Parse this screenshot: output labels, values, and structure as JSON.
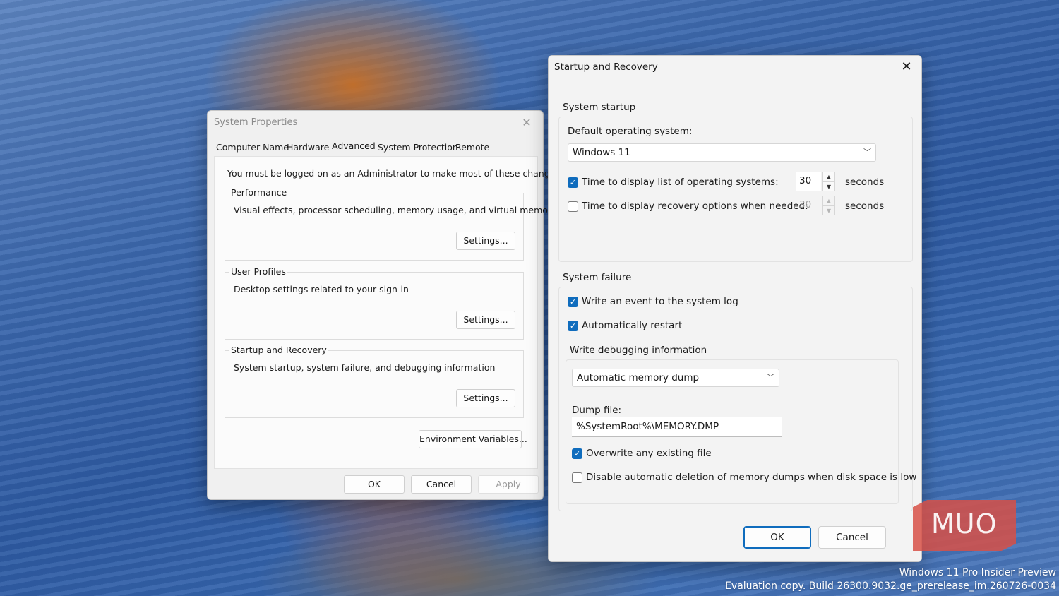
{
  "system_properties": {
    "title": "System Properties",
    "tabs": [
      {
        "label": "Computer Name"
      },
      {
        "label": "Hardware"
      },
      {
        "label": "Advanced"
      },
      {
        "label": "System Protection"
      },
      {
        "label": "Remote"
      }
    ],
    "active_tab": "Advanced",
    "admin_note": "You must be logged on as an Administrator to make most of these changes",
    "performance": {
      "legend": "Performance",
      "description": "Visual effects, processor scheduling, memory usage, and virtual memory",
      "button": "Settings..."
    },
    "user_profiles": {
      "legend": "User Profiles",
      "description": "Desktop settings related to your sign-in",
      "button": "Settings..."
    },
    "startup_recovery": {
      "legend": "Startup and Recovery",
      "description": "System startup, system failure, and debugging information",
      "button": "Settings..."
    },
    "env_button": "Environment Variables...",
    "ok": "OK",
    "cancel": "Cancel",
    "apply": "Apply"
  },
  "startup_recovery_dialog": {
    "title": "Startup and Recovery",
    "system_startup": {
      "title": "System startup",
      "default_os_label": "Default operating system:",
      "default_os_value": "Windows 11",
      "display_list": {
        "label": "Time to display list of operating systems:",
        "checked": true,
        "value": "30",
        "unit": "seconds"
      },
      "display_recovery": {
        "label": "Time to display recovery options when needed:",
        "checked": false,
        "value": "30",
        "unit": "seconds"
      }
    },
    "system_failure": {
      "title": "System failure",
      "write_event": {
        "label": "Write an event to the system log",
        "checked": true
      },
      "auto_restart": {
        "label": "Automatically restart",
        "checked": true
      },
      "debug_title": "Write debugging information",
      "dump_type": "Automatic memory dump",
      "dump_file_label": "Dump file:",
      "dump_file_value": "%SystemRoot%\\MEMORY.DMP",
      "overwrite": {
        "label": "Overwrite any existing file",
        "checked": true
      },
      "disable_auto_delete": {
        "label": "Disable automatic deletion of memory dumps when disk space is low",
        "checked": false
      }
    },
    "ok": "OK",
    "cancel": "Cancel"
  },
  "desktop": {
    "logo_text": "MUO",
    "watermark_line1": "Windows 11 Pro Insider Preview",
    "watermark_line2": "Evaluation copy. Build 26300.9032.ge_prerelease_im.260726-0034"
  },
  "colors": {
    "accent": "#0f6cbd",
    "window_bg": "#f0f0f0"
  },
  "icons": {
    "close": "close-icon",
    "chevron": "chevron-down-icon",
    "check": "checkmark-icon"
  }
}
